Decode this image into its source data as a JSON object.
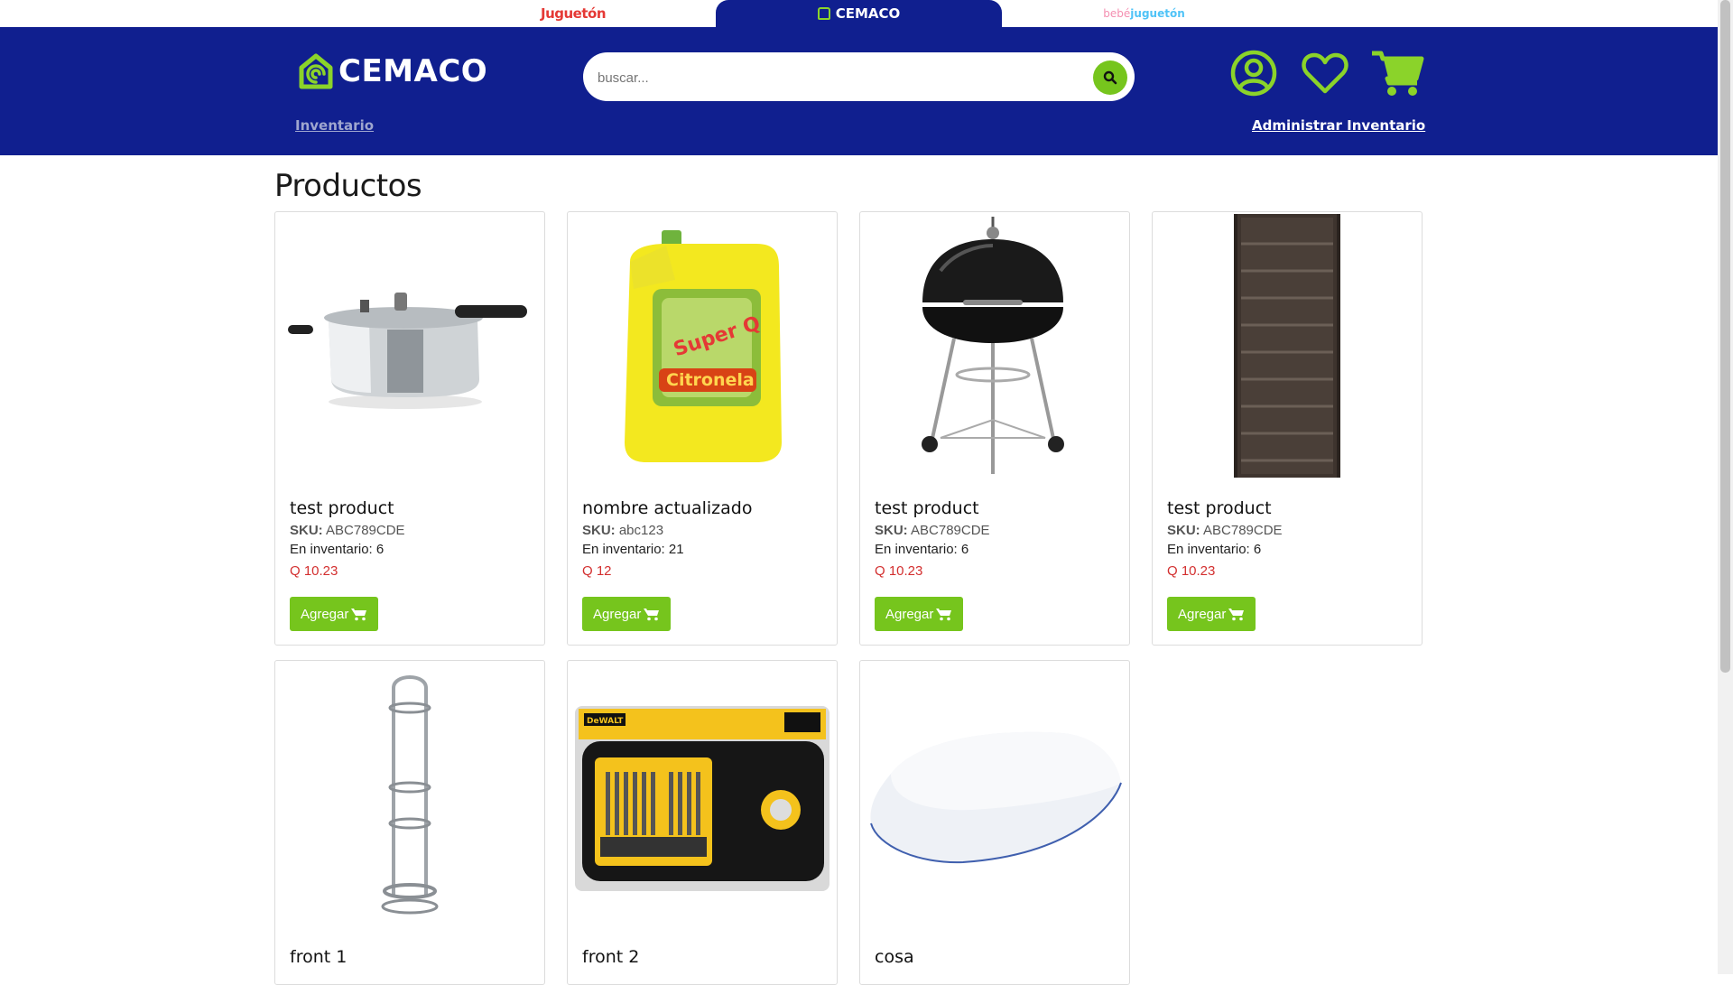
{
  "brand_tabs": {
    "jugueton": "Juguetón",
    "cemaco": "CEMACO",
    "bebe_prefix": "bebé",
    "bebe_suffix": "juguetón"
  },
  "header": {
    "logo_text": "CEMACO",
    "search_placeholder": "buscar...",
    "nav_inventario": "Inventario",
    "nav_admin": "Administrar Inventario"
  },
  "icons": {
    "search": "search-icon",
    "user": "user-icon",
    "wishlist": "heart-icon",
    "cart": "cart-icon"
  },
  "colors": {
    "header_bg": "#101f8f",
    "accent_green": "#76c51d",
    "price_red": "#d32f2f"
  },
  "page_title": "Productos",
  "add_label": "Agregar",
  "sku_label": "SKU:",
  "products": [
    {
      "name": "test product",
      "sku": "ABC789CDE",
      "stock": "En inventario: 6",
      "price": "Q 10.23",
      "image": "pressure-cooker"
    },
    {
      "name": "nombre actualizado",
      "sku": "abc123",
      "stock": "En inventario: 21",
      "price": "Q 12",
      "image": "citronella-jug"
    },
    {
      "name": "test product",
      "sku": "ABC789CDE",
      "stock": "En inventario: 6",
      "price": "Q 10.23",
      "image": "kettle-grill"
    },
    {
      "name": "test product",
      "sku": "ABC789CDE",
      "stock": "En inventario: 6",
      "price": "Q 10.23",
      "image": "shoe-rack"
    },
    {
      "name": "front 1",
      "image": "towel-stand"
    },
    {
      "name": "front 2",
      "image": "dewalt-bit-set"
    },
    {
      "name": "cosa",
      "image": "pillow"
    }
  ]
}
